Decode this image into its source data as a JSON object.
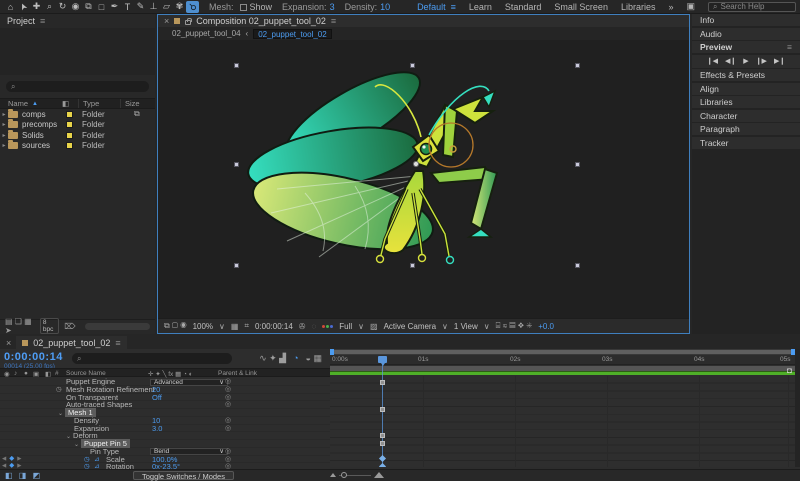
{
  "colors": {
    "accent": "#4c9cf1",
    "layer_bar_green": "#4faf28",
    "label_yellow": "#e8d44a",
    "selection_border": "#3f7fbe"
  },
  "icons": {
    "home": "⌂",
    "selection": "➤",
    "hand": "✚",
    "zoom": "⌕",
    "rotation": "↻",
    "camera": "◉",
    "pan_behind": "⧉",
    "shape": "□",
    "pen": "✒",
    "type": "T",
    "brush": "✎",
    "clone_stamp": "⊥",
    "eraser": "▱",
    "roto_brush": "✾",
    "puppet_pin": "⚲",
    "menu": "≡",
    "close": "×",
    "overflow": "»",
    "chevron_down": "∨",
    "chevron_open": "⌄",
    "crumb_sep": "‹",
    "search": "⌕",
    "sort_asc": "▲",
    "row_arrow": "▸",
    "label_col": "◧",
    "hash": "#",
    "sitemap": "⧉",
    "eye": "◉",
    "audio": "♪",
    "solo": "●",
    "lock": "▣",
    "switch_cluster": "✛ ✦ ╲ fx ▦ ◔ ◐",
    "pickwhip": "◎",
    "stopwatch": "◷",
    "graph": "⊿",
    "kf_prev": "◀",
    "kf_diamond": "◆",
    "kf_next": "▶",
    "tl_cluster_a": "∿  ✦  ▟",
    "tl_blue": "◔",
    "tl_cluster_b": "◒  ▦",
    "transport": [
      "❙◀",
      "◀❙",
      "▶",
      "❙▶",
      "▶❙"
    ],
    "marker_bin": "◘",
    "pane_toggles": "◧ ◨ ◩",
    "cmp_cluster1": "⧉ ▢ ◉",
    "cmp_grid": "▦",
    "cmp_roi": "⌗",
    "cmp_snapshot": "✇",
    "cmp_last": "◌",
    "cmp_trans": "▨",
    "cmp_cluster2": "⌸ ≋ ▤ ❖ ✳",
    "bin_cluster": "▤ ❏ ▦ ➤",
    "trash": "⌦",
    "workspace_toggle": "▣"
  },
  "app": {
    "tool_options": {
      "mesh_label": "Mesh:",
      "show_label": "Show",
      "expansion_label": "Expansion:",
      "expansion_value": "3",
      "density_label": "Density:",
      "density_value": "10"
    },
    "workspaces": {
      "active": "Default",
      "items": [
        "Learn",
        "Standard",
        "Small Screen",
        "Libraries"
      ]
    },
    "search_placeholder": "Search Help"
  },
  "project": {
    "tab": "Project",
    "columns": {
      "name": "Name",
      "type": "Type",
      "size": "Size"
    },
    "rows": [
      {
        "name": "comps",
        "type": "Folder"
      },
      {
        "name": "precomps",
        "type": "Folder"
      },
      {
        "name": "Solids",
        "type": "Folder"
      },
      {
        "name": "sources",
        "type": "Folder"
      }
    ],
    "footer": {
      "bit_depth": "8 bpc"
    }
  },
  "composition": {
    "tab_title": "Composition 02_puppet_tool_02",
    "breadcrumb_parent": "02_puppet_tool_04",
    "breadcrumb_current": "02_puppet_tool_02",
    "toolbar": {
      "magnification": "100%",
      "time": "0:00:00:14",
      "resolution": "Full",
      "camera": "Active Camera",
      "layout": "1 View",
      "exposure": "+0.0"
    }
  },
  "panels": [
    "Info",
    "Audio",
    "Preview",
    "Effects & Presets",
    "Align",
    "Libraries",
    "Character",
    "Paragraph",
    "Tracker"
  ],
  "timeline": {
    "tab": "02_puppet_tool_02",
    "timecode": "0:00:00:14",
    "timecode_sub": "00014 (25.00 fps)",
    "columns": {
      "source_name": "Source Name",
      "parent": "Parent & Link"
    },
    "rows": [
      {
        "label": "Puppet Engine",
        "value": "Advanced"
      },
      {
        "label": "Mesh Rotation Refinement",
        "value": "20"
      },
      {
        "label": "On Transparent",
        "value": "Off"
      },
      {
        "label": "Auto-traced Shapes",
        "value": ""
      },
      {
        "label": "Mesh 1",
        "value": ""
      },
      {
        "label": "Density",
        "value": "10"
      },
      {
        "label": "Expansion",
        "value": "3.0"
      },
      {
        "label": "Deform",
        "value": ""
      },
      {
        "label": "Puppet Pin 5",
        "value": ""
      },
      {
        "label": "Pin Type",
        "value": "Bend"
      },
      {
        "label": "Scale",
        "value": "100.0%"
      },
      {
        "label": "Rotation",
        "value": "0x-23.5°"
      }
    ],
    "ruler": [
      "0:00s",
      "01s",
      "02s",
      "03s",
      "04s",
      "05s"
    ],
    "toggle_button": "Toggle Switches / Modes"
  }
}
